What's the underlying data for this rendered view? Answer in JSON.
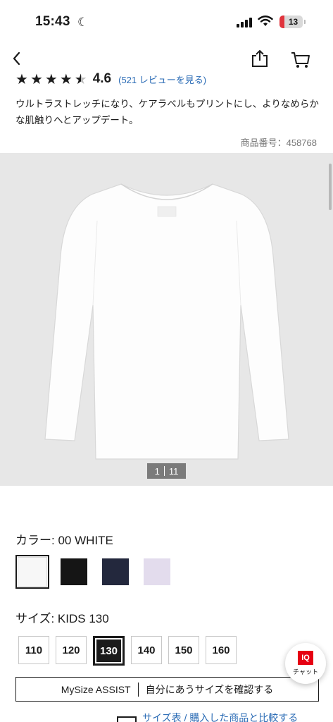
{
  "status": {
    "time": "15:43",
    "battery": "13"
  },
  "rating": {
    "score": "4.6",
    "stars": 4.5,
    "reviews": "(521 レビューを見る)"
  },
  "description": "ウルトラストレッチになり、ケアラベルもプリントにし、よりなめらかな肌触りへとアップデート。",
  "product_number": "商品番号：458768",
  "gallery": {
    "current": "1",
    "total": "11"
  },
  "color": {
    "label": "カラー: 00 WHITE",
    "swatches": [
      {
        "name": "white",
        "hex": "#f7f7f7"
      },
      {
        "name": "black",
        "hex": "#151515"
      },
      {
        "name": "navy",
        "hex": "#23283d"
      },
      {
        "name": "lavender",
        "hex": "#e3dced"
      }
    ]
  },
  "size": {
    "label": "サイズ: KIDS 130",
    "options": [
      "110",
      "120",
      "130",
      "140",
      "150",
      "160"
    ],
    "selected": "130"
  },
  "mysize": {
    "left": "MySize ASSIST",
    "right": "自分にあうサイズを確認する"
  },
  "chat": {
    "badge": "IQ",
    "label": "チャット"
  },
  "bottom_link": "サイズ表 / 購入した商品と比較する"
}
